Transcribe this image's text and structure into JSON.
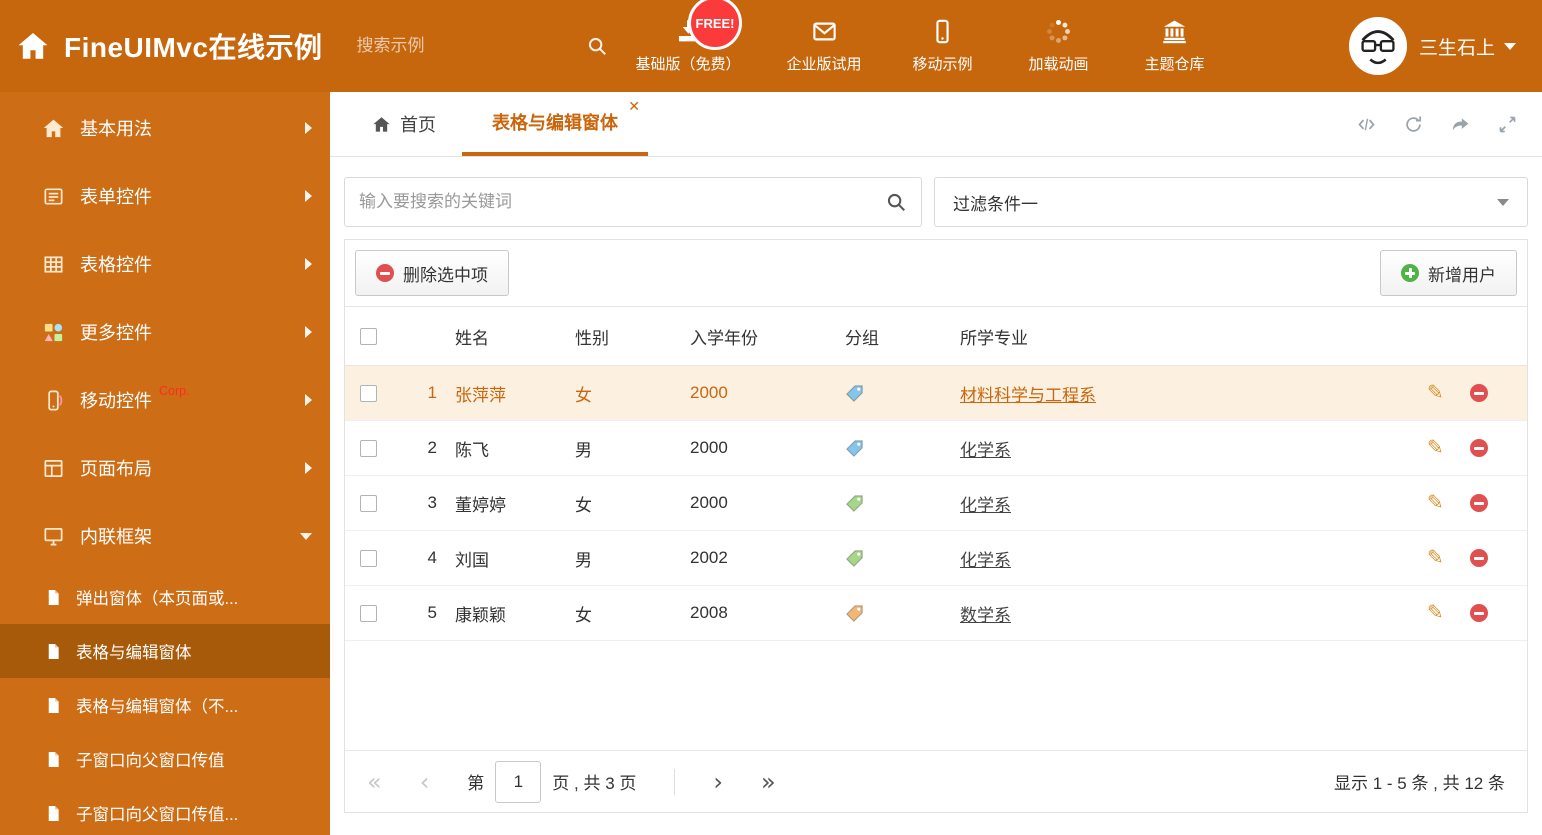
{
  "header": {
    "title": "FineUIMvc在线示例",
    "search_placeholder": "搜索示例",
    "free_badge": "FREE!",
    "nav": [
      {
        "label": "基础版（免费）",
        "icon": "download-icon"
      },
      {
        "label": "企业版试用",
        "icon": "mail-icon"
      },
      {
        "label": "移动示例",
        "icon": "mobile-icon"
      },
      {
        "label": "加载动画",
        "icon": "spinner-icon"
      },
      {
        "label": "主题仓库",
        "icon": "bank-icon"
      }
    ],
    "user": {
      "name": "三生石上"
    }
  },
  "sidebar": {
    "items": [
      {
        "label": "基本用法",
        "icon": "home-icon"
      },
      {
        "label": "表单控件",
        "icon": "form-icon"
      },
      {
        "label": "表格控件",
        "icon": "grid-icon"
      },
      {
        "label": "更多控件",
        "icon": "widgets-icon"
      },
      {
        "label": "移动控件",
        "badge": "Corp.",
        "icon": "mobile-icon"
      },
      {
        "label": "页面布局",
        "icon": "layout-icon"
      },
      {
        "label": "内联框架",
        "icon": "frame-icon"
      }
    ],
    "subitems": [
      {
        "label": "弹出窗体（本页面或..."
      },
      {
        "label": "表格与编辑窗体"
      },
      {
        "label": "表格与编辑窗体（不..."
      },
      {
        "label": "子窗口向父窗口传值"
      },
      {
        "label": "子窗口向父窗口传值..."
      }
    ]
  },
  "tabs": {
    "home": "首页",
    "active": "表格与编辑窗体"
  },
  "filter": {
    "search_placeholder": "输入要搜索的关键词",
    "dropdown_value": "过滤条件一"
  },
  "toolbar": {
    "delete_label": "删除选中项",
    "add_label": "新增用户"
  },
  "table": {
    "headers": {
      "name": "姓名",
      "gender": "性别",
      "year": "入学年份",
      "group": "分组",
      "major": "所学专业"
    },
    "rows": [
      {
        "num": "1",
        "name": "张萍萍",
        "gender": "女",
        "year": "2000",
        "tag_color": "#86c5ea",
        "major": "材料科学与工程系"
      },
      {
        "num": "2",
        "name": "陈飞",
        "gender": "男",
        "year": "2000",
        "tag_color": "#86c5ea",
        "major": "化学系"
      },
      {
        "num": "3",
        "name": "董婷婷",
        "gender": "女",
        "year": "2000",
        "tag_color": "#a7d68b",
        "major": "化学系"
      },
      {
        "num": "4",
        "name": "刘国",
        "gender": "男",
        "year": "2002",
        "tag_color": "#a7d68b",
        "major": "化学系"
      },
      {
        "num": "5",
        "name": "康颖颖",
        "gender": "女",
        "year": "2008",
        "tag_color": "#f2b678",
        "major": "数学系"
      }
    ]
  },
  "pagination": {
    "page_label_before": "第",
    "current_page": "1",
    "page_label_after": "页 , 共 3 页",
    "summary": "显示 1 - 5 条 , 共 12 条"
  },
  "colors": {
    "accent": "#c9660e",
    "header_bg": "#c6660d",
    "sidebar_bg": "#cd6d15",
    "selected_row_bg": "#fcf1e1"
  }
}
